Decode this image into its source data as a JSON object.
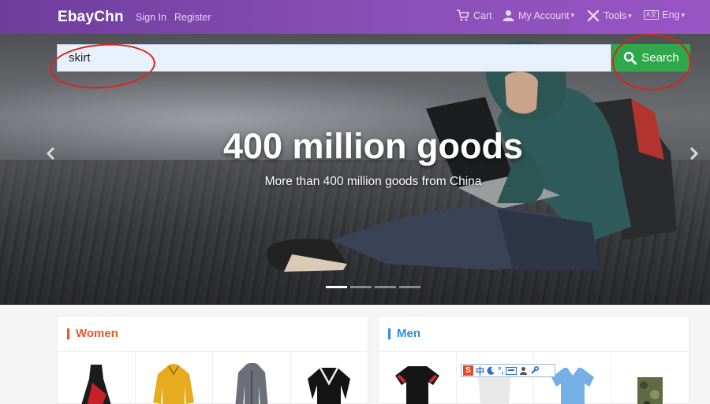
{
  "navbar": {
    "brand": "EbayChn",
    "sign_in": "Sign In",
    "register": "Register",
    "cart": "Cart",
    "my_account": "My Account",
    "tools": "Tools",
    "language": "Eng",
    "language_badge": "A文"
  },
  "search": {
    "value": "skirt",
    "button_label": "Search"
  },
  "hero": {
    "title": "400 million goods",
    "subtitle": "More than 400 million goods from China",
    "slides_total": 4,
    "active_slide": 1
  },
  "categories": {
    "women": {
      "title": "Women"
    },
    "men": {
      "title": "Men"
    }
  },
  "ime_toolbar": {
    "logo": "S",
    "mode": "中"
  },
  "colors": {
    "navbar": "#7b45aa",
    "search_button": "#2ea84a",
    "annotation": "#d8241c",
    "women_accent": "#e6572a",
    "men_accent": "#2d8fd8"
  }
}
